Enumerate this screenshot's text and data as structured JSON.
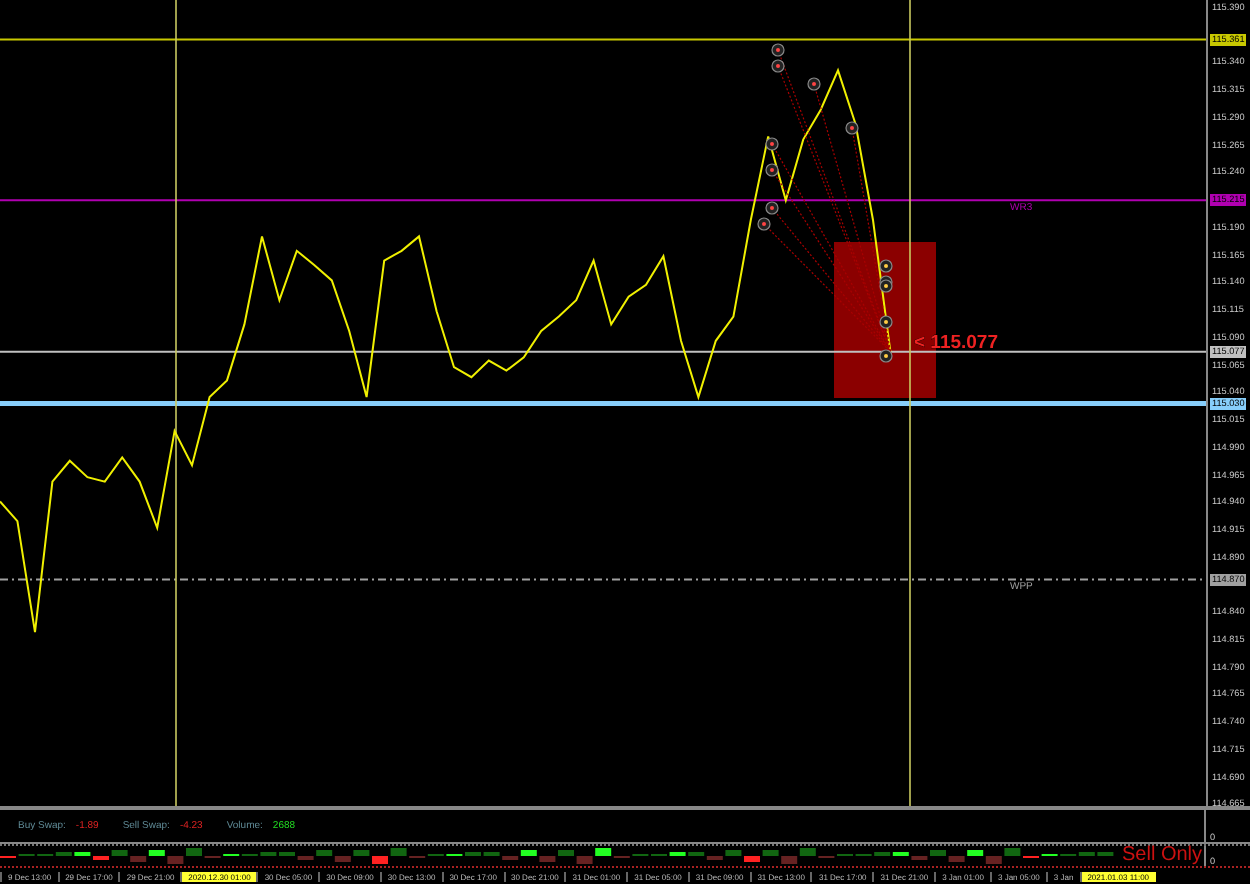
{
  "chart": {
    "price_axis_labels": [
      "115.390",
      "115.340",
      "115.315",
      "115.290",
      "115.265",
      "115.240",
      "115.190",
      "115.165",
      "115.140",
      "115.115",
      "115.090",
      "115.065",
      "115.040",
      "115.015",
      "114.990",
      "114.965",
      "114.940",
      "114.915",
      "114.890",
      "114.840",
      "114.815",
      "114.790",
      "114.765",
      "114.740",
      "114.715",
      "114.690",
      "114.665"
    ],
    "levels": [
      {
        "kind": "line",
        "price": "115.361",
        "color": "#c8c800"
      },
      {
        "kind": "pivot",
        "name": "WR3",
        "price": "115.215",
        "color": "#b000b0"
      },
      {
        "kind": "line",
        "price": "115.077",
        "color": "#c0c0c0"
      },
      {
        "kind": "thick",
        "price": "115.030",
        "color": "#87cefa"
      },
      {
        "kind": "pivot",
        "name": "WPP",
        "price": "114.870",
        "color": "#a0a0a0"
      }
    ],
    "price_label": "< 115.077"
  },
  "swap_panel": {
    "items": [
      {
        "label": "Buy Swap:",
        "value": "-1.89",
        "kind": "loss"
      },
      {
        "label": "Sell Swap:",
        "value": "-4.23",
        "kind": "loss"
      },
      {
        "label": "Volume:",
        "value": "2688",
        "kind": "gain"
      }
    ],
    "axis_label": "0"
  },
  "histogram_panel": {
    "axis_label": "0",
    "mode": "Sell Only"
  },
  "time_axis": {
    "labels": [
      {
        "text": "9 Dec 13:00",
        "highlighted": false
      },
      {
        "text": "29 Dec 17:00",
        "highlighted": false
      },
      {
        "text": "29 Dec 21:00",
        "highlighted": false
      },
      {
        "text": "2020.12.30 01:00",
        "highlighted": true
      },
      {
        "text": "30 Dec 05:00",
        "highlighted": false
      },
      {
        "text": "30 Dec 09:00",
        "highlighted": false
      },
      {
        "text": "30 Dec 13:00",
        "highlighted": false
      },
      {
        "text": "30 Dec 17:00",
        "highlighted": false
      },
      {
        "text": "30 Dec 21:00",
        "highlighted": false
      },
      {
        "text": "31 Dec 01:00",
        "highlighted": false
      },
      {
        "text": "31 Dec 05:00",
        "highlighted": false
      },
      {
        "text": "31 Dec 09:00",
        "highlighted": false
      },
      {
        "text": "31 Dec 13:00",
        "highlighted": false
      },
      {
        "text": "31 Dec 17:00",
        "highlighted": false
      },
      {
        "text": "31 Dec 21:00",
        "highlighted": false
      },
      {
        "text": "3 Jan 01:00",
        "highlighted": false
      },
      {
        "text": "3 Jan 05:00",
        "highlighted": false
      },
      {
        "text": "3 Jan",
        "highlighted": false
      },
      {
        "text": "2021.01.03 11:00",
        "highlighted": true
      }
    ]
  }
}
